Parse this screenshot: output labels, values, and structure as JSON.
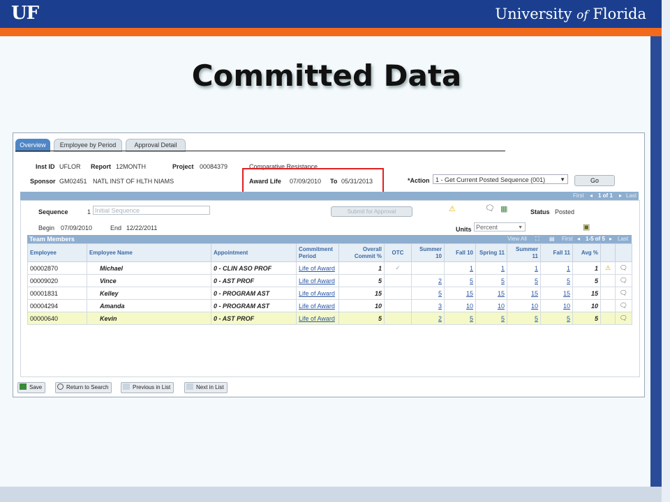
{
  "header": {
    "logo": "UF",
    "university_pre": "University ",
    "university_of": "of",
    "university_post": " Florida"
  },
  "slide_title": "Committed Data",
  "tabs": [
    "Overview",
    "Employee by Period",
    "Approval Detail"
  ],
  "info": {
    "inst_id_label": "Inst ID",
    "inst_id": "UFLOR",
    "report_label": "Report",
    "report": "12MONTH",
    "project_label": "Project",
    "project": "00084379",
    "project_name": "Comparative Resistance",
    "sponsor_label": "Sponsor",
    "sponsor": "GM02451",
    "sponsor_name": "NATL INST OF HLTH NIAMS",
    "award_life_label": "Award Life",
    "award_start": "07/09/2010",
    "to_label": "To",
    "award_end": "05/31/2013",
    "action_label": "*Action",
    "action_value": "1 - Get Current Posted Sequence (001)",
    "go": "Go"
  },
  "nav": {
    "first": "First",
    "count": "1 of 1",
    "last": "Last"
  },
  "sequence": {
    "label": "Sequence",
    "value": "1",
    "placeholder": "Initial Sequence",
    "submit": "Submit for Approval",
    "status_label": "Status",
    "status": "Posted",
    "begin_label": "Begin",
    "begin": "07/09/2010",
    "end_label": "End",
    "end": "12/22/2011",
    "units_label": "Units",
    "units": "Percent"
  },
  "team": {
    "title": "Team Members",
    "nav": {
      "view_all": "View All",
      "first": "First",
      "count": "1-5 of 5",
      "last": "Last"
    },
    "columns": [
      "Employee",
      "Employee Name",
      "Appointment",
      "Commitment Period",
      "Overall Commit %",
      "OTC",
      "Summer 10",
      "Fall 10",
      "Spring 11",
      "Summer 11",
      "Fall 11",
      "Avg %"
    ],
    "rows": [
      {
        "emp": "00002870",
        "name": "Michael",
        "appt": "0 - CLIN ASO PROF",
        "period": "Life of Award",
        "overall": "1",
        "otc": "✓",
        "s10": "",
        "f10": "1",
        "sp11": "1",
        "s11": "1",
        "f11": "1",
        "avg": "1",
        "warn": "⚠"
      },
      {
        "emp": "00009020",
        "name": "Vince",
        "appt": "0 - AST PROF",
        "period": "Life of Award",
        "overall": "5",
        "otc": "",
        "s10": "2",
        "f10": "5",
        "sp11": "5",
        "s11": "5",
        "f11": "5",
        "avg": "5",
        "warn": ""
      },
      {
        "emp": "00001831",
        "name": "Kelley",
        "appt": "0 - PROGRAM AST",
        "period": "Life of Award",
        "overall": "15",
        "otc": "",
        "s10": "5",
        "f10": "15",
        "sp11": "15",
        "s11": "15",
        "f11": "15",
        "avg": "15",
        "warn": ""
      },
      {
        "emp": "00004294",
        "name": "Amanda",
        "appt": "0 - PROGRAM AST",
        "period": "Life of Award",
        "overall": "10",
        "otc": "",
        "s10": "3",
        "f10": "10",
        "sp11": "10",
        "s11": "10",
        "f11": "10",
        "avg": "10",
        "warn": ""
      },
      {
        "emp": "00000640",
        "name": "Kevin",
        "appt": "0 - AST PROF",
        "period": "Life of Award",
        "overall": "5",
        "otc": "",
        "s10": "2",
        "f10": "5",
        "sp11": "5",
        "s11": "5",
        "f11": "5",
        "avg": "5",
        "warn": ""
      }
    ]
  },
  "bottom_buttons": [
    "Save",
    "Return to Search",
    "Previous in List",
    "Next in List"
  ],
  "icons": {
    "warning": "warning-icon",
    "comment": "comment-icon",
    "grid": "grid-icon",
    "folder": "folder-icon"
  },
  "colors": {
    "header_blue": "#1b3f8e",
    "orange": "#f26a1b",
    "tab_active": "#4f86c6",
    "highlight": "#f5f9c8",
    "award_box": "#e02020"
  }
}
